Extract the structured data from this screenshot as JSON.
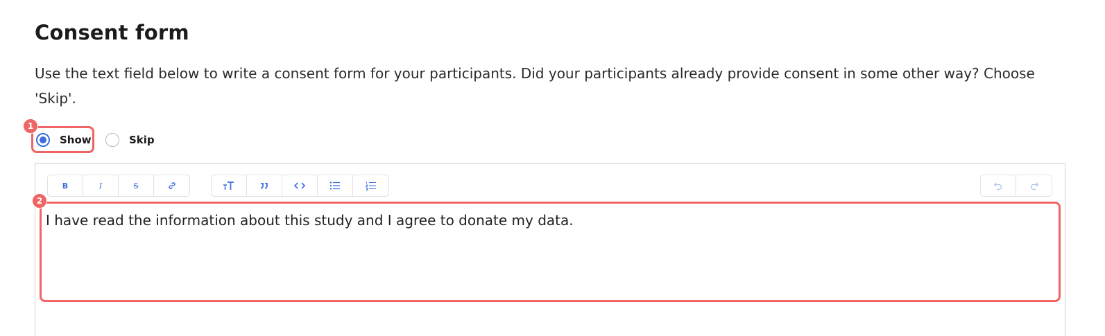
{
  "page": {
    "title": "Consent form",
    "description": "Use the text field below to write a consent form for your participants. Did your participants already provide consent in some other way? Choose 'Skip'."
  },
  "consent_mode": {
    "options": [
      {
        "label": "Show",
        "selected": true
      },
      {
        "label": "Skip",
        "selected": false
      }
    ]
  },
  "editor": {
    "toolbar_format": [
      {
        "icon": "bold-icon",
        "label": "B"
      },
      {
        "icon": "italic-icon",
        "label": "I"
      },
      {
        "icon": "strikethrough-icon",
        "label": "S"
      },
      {
        "icon": "link-icon",
        "label": ""
      }
    ],
    "toolbar_blocks": [
      {
        "icon": "heading-icon",
        "label": "TT"
      },
      {
        "icon": "quote-icon",
        "label": "”"
      },
      {
        "icon": "code-icon",
        "label": "<>"
      },
      {
        "icon": "bullet-list-icon",
        "label": ""
      },
      {
        "icon": "numbered-list-icon",
        "label": ""
      }
    ],
    "toolbar_history": [
      {
        "icon": "undo-icon",
        "label": ""
      },
      {
        "icon": "redo-icon",
        "label": ""
      }
    ],
    "content": "I have read the information about this study and I agree to donate my data."
  },
  "annotations": {
    "badge_1": "1",
    "badge_2": "2",
    "color": "#ef6464"
  },
  "colors": {
    "accent": "#3b6fe0",
    "text": "#1f1f1f"
  }
}
